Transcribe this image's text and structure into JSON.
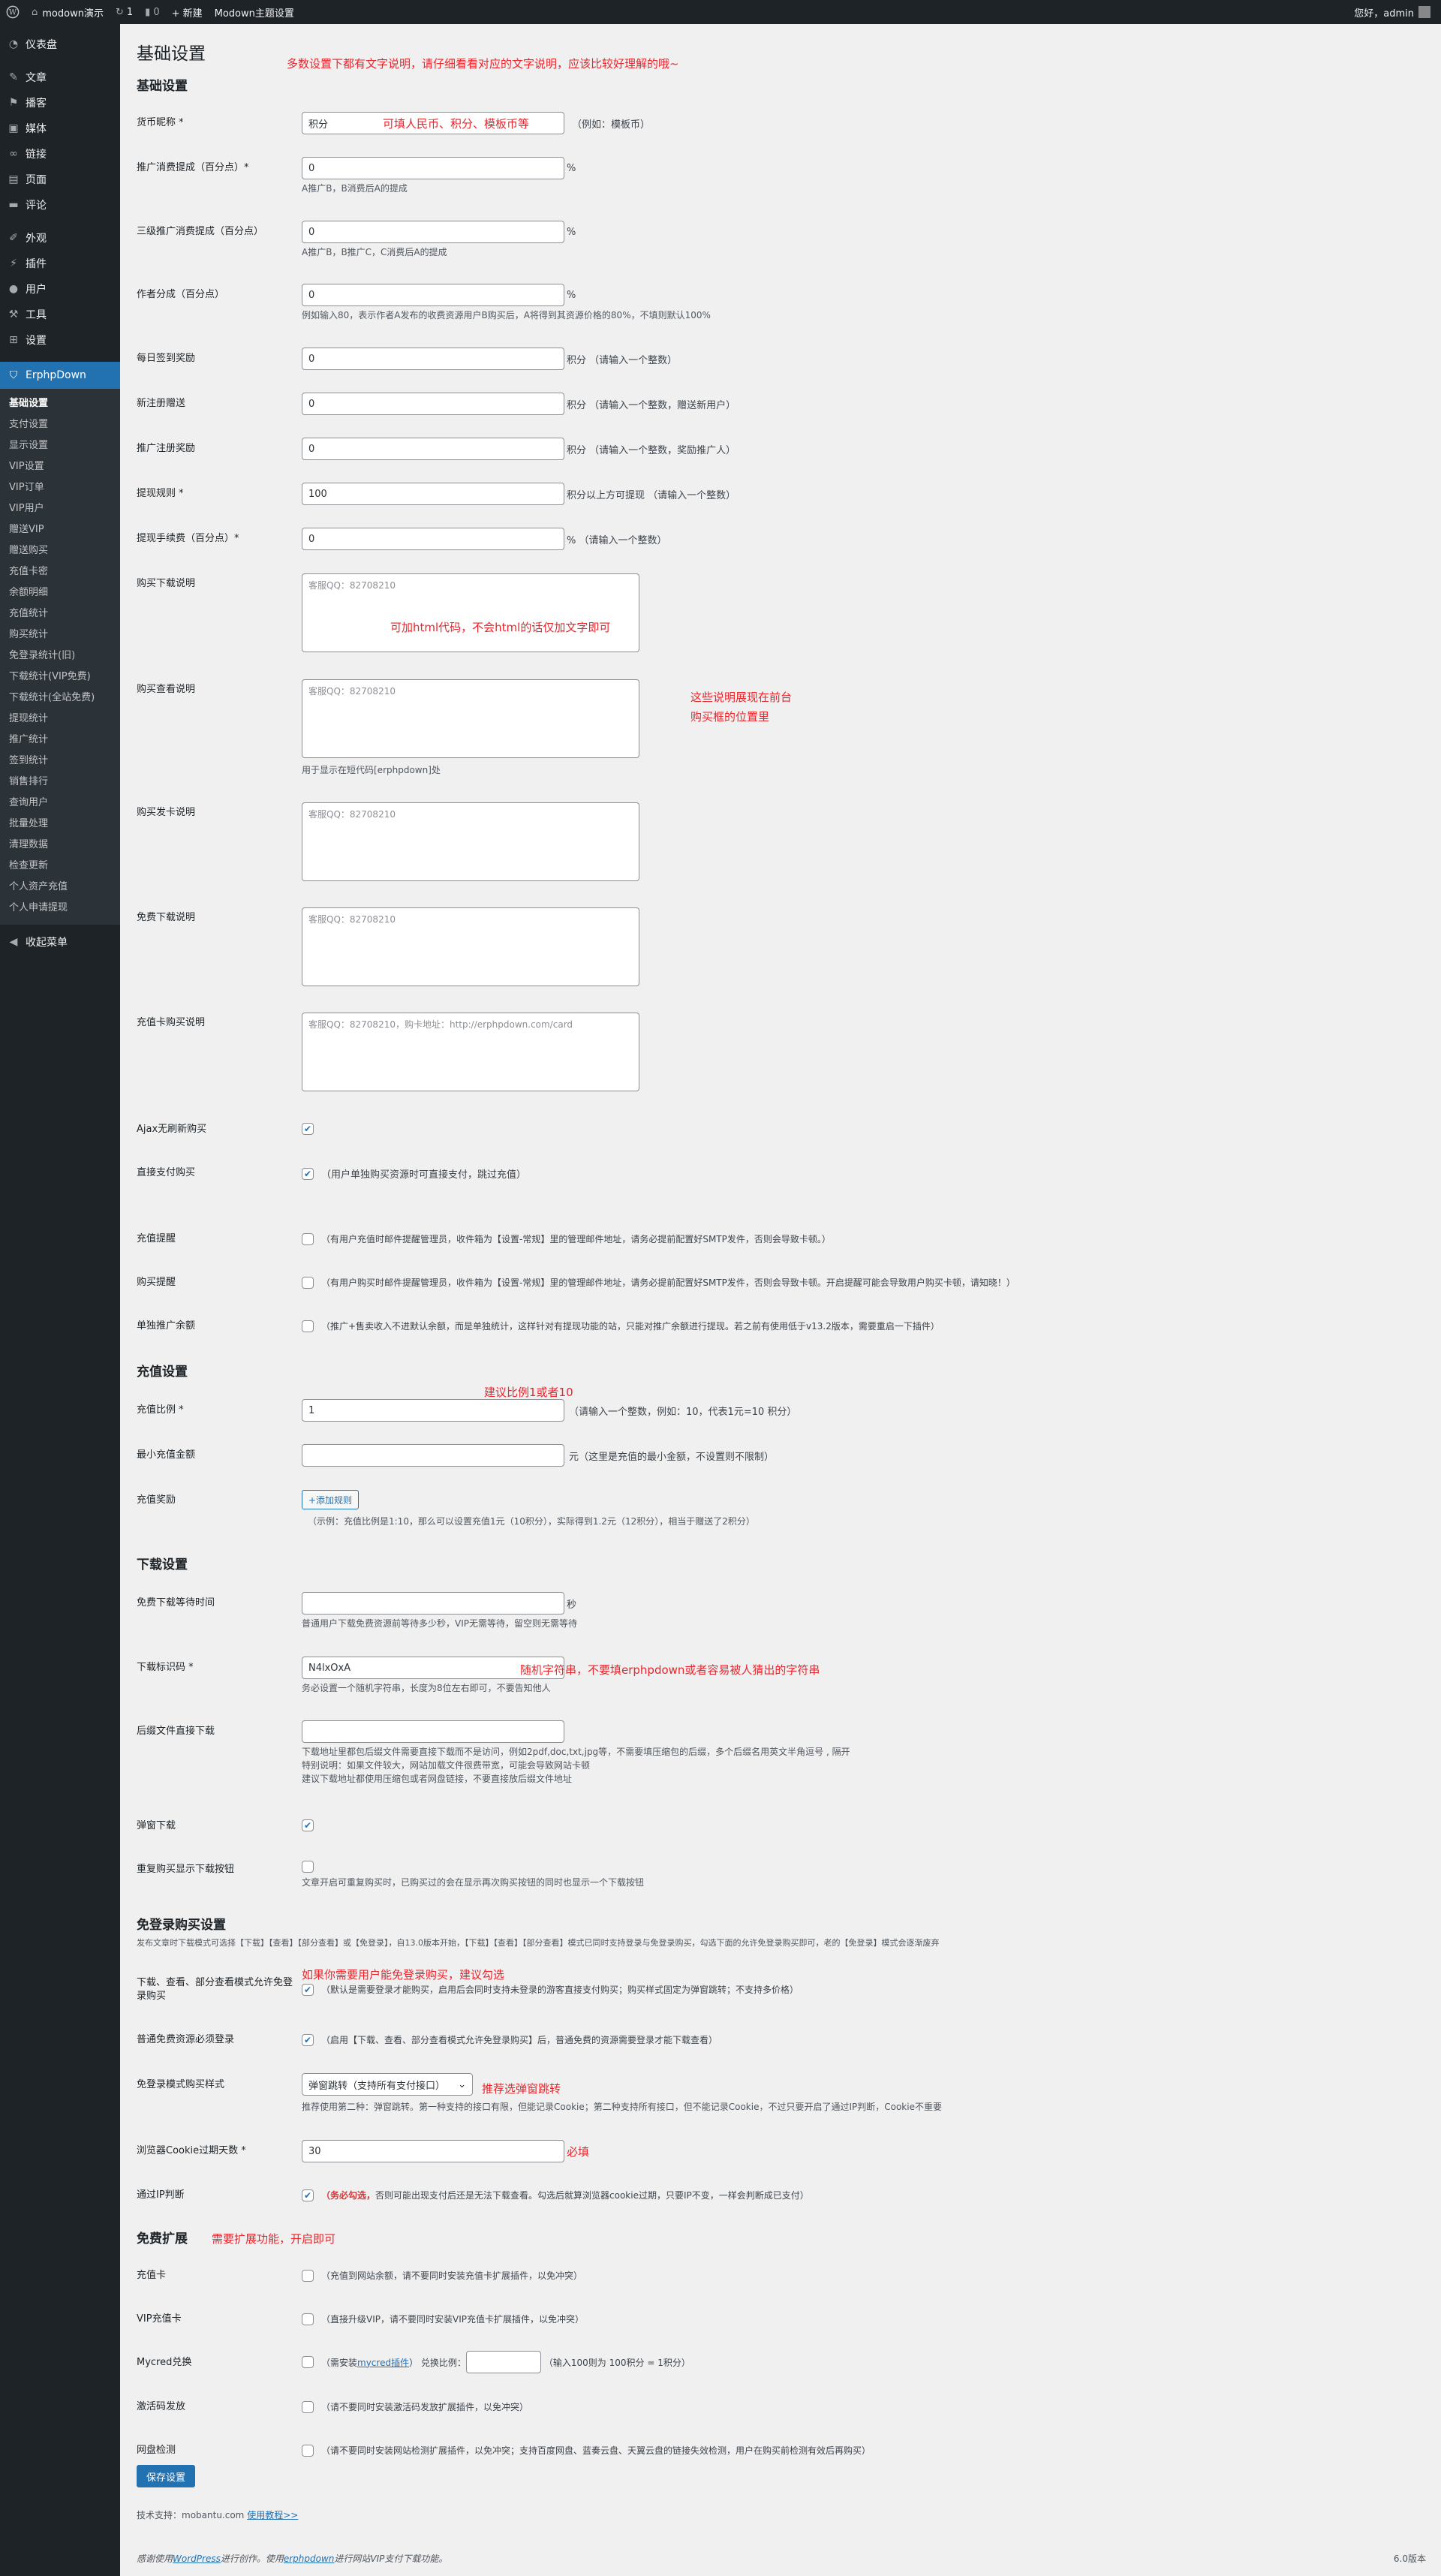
{
  "adminbar": {
    "wp_icon": "wordpress-icon",
    "site": "modown演示",
    "updates": "1",
    "comments": "0",
    "new": "+ 新建",
    "theme_settings": "Modown主题设置",
    "greeting": "您好，admin"
  },
  "sidebar": {
    "top_items": [
      {
        "label": "仪表盘",
        "icon": "dashboard-icon"
      },
      {
        "label": "文章",
        "icon": "pin-icon"
      },
      {
        "label": "播客",
        "icon": "flag-icon"
      },
      {
        "label": "媒体",
        "icon": "media-icon"
      },
      {
        "label": "链接",
        "icon": "link-icon"
      },
      {
        "label": "页面",
        "icon": "page-icon"
      },
      {
        "label": "评论",
        "icon": "comment-icon"
      }
    ],
    "mid_items": [
      {
        "label": "外观",
        "icon": "brush-icon"
      },
      {
        "label": "插件",
        "icon": "plugin-icon"
      },
      {
        "label": "用户",
        "icon": "user-icon"
      },
      {
        "label": "工具",
        "icon": "wrench-icon"
      },
      {
        "label": "设置",
        "icon": "settings-icon"
      }
    ],
    "active": "ErphpDown",
    "submenu": [
      "基础设置",
      "支付设置",
      "显示设置",
      "VIP设置",
      "VIP订单",
      "VIP用户",
      "赠送VIP",
      "赠送购买",
      "充值卡密",
      "余额明细",
      "充值统计",
      "购买统计",
      "免登录统计(旧)",
      "下载统计(VIP免费)",
      "下载统计(全站免费)",
      "提现统计",
      "推广统计",
      "签到统计",
      "销售排行",
      "查询用户",
      "批量处理",
      "清理数据",
      "检查更新",
      "个人资产充值",
      "个人申请提现"
    ],
    "collapse": "收起菜单"
  },
  "page": {
    "title": "基础设置",
    "title_note": "多数设置下都有文字说明，请仔细看看对应的文字说明，应该比较好理解的哦~"
  },
  "s1": {
    "title": "基础设置",
    "currency": {
      "label": "货币昵称 *",
      "value": "积分",
      "hint": "（例如：模板币）",
      "note": "可填人民币、积分、模板币等"
    },
    "promo": {
      "label": "推广消费提成（百分点）*",
      "value": "0",
      "unit": "%",
      "desc": "A推广B，B消费后A的提成"
    },
    "promo3": {
      "label": "三级推广消费提成（百分点）",
      "value": "0",
      "unit": "%",
      "desc": "A推广B，B推广C，C消费后A的提成"
    },
    "author": {
      "label": "作者分成（百分点）",
      "value": "0",
      "unit": "%",
      "desc": "例如输入80，表示作者A发布的收费资源用户B购买后，A将得到其资源价格的80%，不填则默认100%"
    },
    "checkin": {
      "label": "每日签到奖励",
      "value": "0",
      "unit": "积分 （请输入一个整数）"
    },
    "newreg": {
      "label": "新注册赠送",
      "value": "0",
      "unit": "积分 （请输入一个整数，赠送新用户）"
    },
    "promoreg": {
      "label": "推广注册奖励",
      "value": "0",
      "unit": "积分 （请输入一个整数，奖励推广人）"
    },
    "withdraw": {
      "label": "提现规则 *",
      "value": "100",
      "unit": "积分以上方可提现 （请输入一个整数）"
    },
    "fee": {
      "label": "提现手续费（百分点）*",
      "value": "0",
      "unit": "% （请输入一个整数）"
    },
    "buy_dl": {
      "label": "购买下载说明",
      "value": "客服QQ：82708210",
      "note": "可加html代码，不会html的话仅加文字即可"
    },
    "buy_view": {
      "label": "购买查看说明",
      "value": "客服QQ：82708210",
      "desc": "用于显示在短代码[erphpdown]处",
      "note1": "这些说明展现在前台",
      "note2": "购买框的位置里"
    },
    "buy_card": {
      "label": "购买发卡说明",
      "value": "客服QQ：82708210"
    },
    "free_dl": {
      "label": "免费下载说明",
      "value": "客服QQ：82708210"
    },
    "recharge_card": {
      "label": "充值卡购买说明",
      "value": "客服QQ：82708210，购卡地址：http://erphpdown.com/card"
    },
    "ajax": {
      "label": "Ajax无刷新购买"
    },
    "direct": {
      "label": "直接支付购买",
      "text": "（用户单独购买资源时可直接支付，跳过充值）"
    },
    "remind_charge": {
      "label": "充值提醒",
      "text": "（有用户充值时邮件提醒管理员，收件箱为【设置-常规】里的管理邮件地址，请务必提前配置好SMTP发件，否则会导致卡顿。）"
    },
    "remind_buy": {
      "label": "购买提醒",
      "text": "（有用户购买时邮件提醒管理员，收件箱为【设置-常规】里的管理邮件地址，请务必提前配置好SMTP发件，否则会导致卡顿。开启提醒可能会导致用户购买卡顿，请知晓！）"
    },
    "separate": {
      "label": "单独推广余额",
      "text": "（推广+售卖收入不进默认余额，而是单独统计，这样针对有提现功能的站，只能对推广余额进行提现。若之前有使用低于v13.2版本，需要重启一下插件）"
    }
  },
  "s2": {
    "title": "充值设置",
    "ratio": {
      "label": "充值比例 *",
      "value": "1",
      "hint": "（请输入一个整数，例如：10，代表1元=10 积分）",
      "note": "建议比例1或者10"
    },
    "min": {
      "label": "最小充值金额",
      "value": "",
      "hint": "元（这里是充值的最小金额，不设置则不限制）"
    },
    "reward": {
      "label": "充值奖励",
      "button": "+添加规则",
      "desc": "（示例：充值比例是1:10，那么可以设置充值1元（10积分），实际得到1.2元（12积分），相当于赠送了2积分）"
    }
  },
  "s3": {
    "title": "下载设置",
    "wait": {
      "label": "免费下载等待时间",
      "value": "",
      "unit": "秒",
      "desc": "普通用户下载免费资源前等待多少秒，VIP无需等待，留空则无需等待"
    },
    "key": {
      "label": "下载标识码 *",
      "value": "N4lxOxA",
      "desc": "务必设置一个随机字符串，长度为8位左右即可，不要告知他人",
      "note": "随机字符串，不要填erphpdown或者容易被人猜出的字符串"
    },
    "suffix": {
      "label": "后缀文件直接下载",
      "value": "",
      "desc1": "下载地址里都包后缀文件需要直接下载而不是访问，例如2pdf,doc,txt,jpg等，不需要填压缩包的后缀，多个后缀名用英文半角逗号 , 隔开",
      "desc2": "特别说明：如果文件较大，网站加载文件很费带宽，可能会导致网站卡顿",
      "desc3": "建议下载地址都使用压缩包或者网盘链接，不要直接放后缀文件地址"
    },
    "popup": {
      "label": "弹窗下载"
    },
    "repeat": {
      "label": "重复购买显示下载按钮",
      "desc": "文章开启可重复购买时，已购买过的会在显示再次购买按钮的同时也显示一个下载按钮"
    }
  },
  "s4": {
    "title": "免登录购买设置",
    "intro": "发布文章时下载模式可选择【下载】【查看】【部分查看】或【免登录】，自13.0版本开始，【下载】【查看】【部分查看】模式已同时支持登录与免登录购买，勾选下面的允许免登录购买即可，老的【免登录】模式会逐渐废弃",
    "allow": {
      "label": "下载、查看、部分查看模式允许免登录购买",
      "text": "（默认是需要登录才能购买，启用后会同时支持未登录的游客直接支付购买；购买样式固定为弹窗跳转；不支持多价格）",
      "note": "如果你需要用户能免登录购买，建议勾选"
    },
    "normal": {
      "label": "普通免费资源必须登录",
      "text": "（启用【下载、查看、部分查看模式允许免登录购买】后，普通免费的资源需要登录才能下载查看）"
    },
    "style": {
      "label": "免登录模式购买样式",
      "value": "弹窗跳转（支持所有支付接口）",
      "desc": "推荐使用第二种：弹窗跳转。第一种支持的接口有限，但能记录Cookie；第二种支持所有接口，但不能记录Cookie，不过只要开启了通过IP判断，Cookie不重要",
      "note": "推荐选弹窗跳转"
    },
    "cookie": {
      "label": "浏览器Cookie过期天数 *",
      "value": "30",
      "note": "必填"
    },
    "ip": {
      "label": "通过IP判断",
      "strong": "（务必勾选，",
      "text": "否则可能出现支付后还是无法下载查看。勾选后就算浏览器cookie过期，只要IP不变，一样会判断成已支付）"
    }
  },
  "s5": {
    "title": "免费扩展",
    "note": "需要扩展功能，开启即可",
    "card": {
      "label": "充值卡",
      "text": "（充值到网站余额，请不要同时安装充值卡扩展插件，以免冲突）"
    },
    "vipcard": {
      "label": "VIP充值卡",
      "text": "（直接升级VIP，请不要同时安装VIP充值卡扩展插件，以免冲突）"
    },
    "mycred": {
      "label": "Mycred兑换",
      "pre": "（需安装",
      "link": "mycred插件",
      "mid": "）  兑换比例：",
      "post": "（输入100则为 100积分 = 1积分）"
    },
    "activation": {
      "label": "激活码发放",
      "text": "（请不要同时安装激活码发放扩展插件，以免冲突）"
    },
    "netdisk": {
      "label": "网盘检测",
      "text": "（请不要同时安装网站检测扩展插件，以免冲突；支持百度网盘、蓝奏云盘、天翼云盘的链接失效检测，用户在购买前检测有效后再购买）"
    }
  },
  "save": "保存设置",
  "support": {
    "text": "技术支持：mobantu.com",
    "link": "使用教程>>"
  },
  "footer": {
    "pre": "感谢使用",
    "wp": "WordPress",
    "mid": "进行创作。使用",
    "erphp": "erphpdown",
    "post": "进行网站VIP支付下载功能。",
    "version": "6.0版本"
  }
}
